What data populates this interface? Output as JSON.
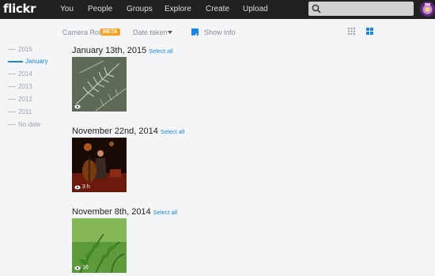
{
  "logo": "flickr",
  "nav": [
    {
      "label": "You"
    },
    {
      "label": "People"
    },
    {
      "label": "Groups"
    },
    {
      "label": "Explore"
    },
    {
      "label": "Create"
    },
    {
      "label": "Upload"
    }
  ],
  "search": {
    "value": "",
    "placeholder": ""
  },
  "subheader": {
    "camera_roll": "Camera Roll",
    "beta": "BETA",
    "sort": "Date taken",
    "show_info": "Show info",
    "show_info_checked": true
  },
  "timeline": [
    {
      "label": "2015",
      "active": false
    },
    {
      "label": "January",
      "active": true
    },
    {
      "label": "2014",
      "active": false
    },
    {
      "label": "2013",
      "active": false
    },
    {
      "label": "2012",
      "active": false
    },
    {
      "label": "2011",
      "active": false
    },
    {
      "label": "No date",
      "active": false
    }
  ],
  "groups": [
    {
      "date": "January 13th, 2015",
      "select_all": "Select all",
      "overlay_count": "",
      "thumb": "pine-branches"
    },
    {
      "date": "November 22nd, 2014",
      "select_all": "Select all",
      "overlay_count": "3 h",
      "thumb": "musician-stage"
    },
    {
      "date": "November 8th, 2014",
      "select_all": "Select all",
      "overlay_count": "16",
      "thumb": "green-plant"
    }
  ],
  "colors": {
    "topbar": "#212124",
    "accent": "#1b86e4",
    "beta": "#ff9f1a",
    "background": "#f3f5f6"
  }
}
